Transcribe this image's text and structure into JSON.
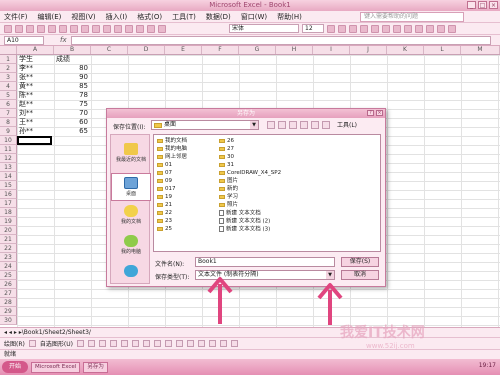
{
  "window": {
    "title": "Microsoft Excel - Book1"
  },
  "menu": {
    "items": [
      "文件(F)",
      "编辑(E)",
      "视图(V)",
      "插入(I)",
      "格式(O)",
      "工具(T)",
      "数据(D)",
      "窗口(W)",
      "帮助(H)"
    ],
    "help_placeholder": "键入需要帮助的问题"
  },
  "toolbar": {
    "font": "宋体",
    "size": "12"
  },
  "formula": {
    "namebox": "A10",
    "fx": "fx"
  },
  "columns": [
    "A",
    "B",
    "C",
    "D",
    "E",
    "F",
    "G",
    "H",
    "I",
    "J",
    "K",
    "L",
    "M"
  ],
  "rows": [
    "1",
    "2",
    "3",
    "4",
    "5",
    "6",
    "7",
    "8",
    "9",
    "10",
    "11",
    "12",
    "13",
    "14",
    "15",
    "16",
    "17",
    "18",
    "19",
    "20",
    "21",
    "22",
    "23",
    "24",
    "25",
    "26",
    "27",
    "28",
    "29",
    "30"
  ],
  "sheet": {
    "header": {
      "a": "学生",
      "b": "成绩"
    },
    "data": [
      {
        "name": "李**",
        "score": "80"
      },
      {
        "name": "张**",
        "score": "90"
      },
      {
        "name": "黄**",
        "score": "85"
      },
      {
        "name": "陈**",
        "score": "78"
      },
      {
        "name": "赵**",
        "score": "75"
      },
      {
        "name": "刘**",
        "score": "70"
      },
      {
        "name": "王**",
        "score": "60"
      },
      {
        "name": "孙**",
        "score": "65"
      }
    ]
  },
  "dialog": {
    "title": "另存为",
    "save_in_label": "保存位置(I):",
    "save_in_value": "桌面",
    "tools_label": "工具(L)",
    "places": [
      "我最近的文档",
      "桌面",
      "我的文档",
      "我的电脑",
      "网上邻居"
    ],
    "files_col1": [
      "我的文档",
      "我的电脑",
      "网上邻居",
      "01",
      "07",
      "09",
      "017",
      "19",
      "21",
      "22",
      "23",
      "25"
    ],
    "files_col2": [
      "26",
      "27",
      "30",
      "31",
      "CorelDRAW_X4_SP2",
      "图片",
      "新的",
      "学习",
      "照片",
      "新建 文本文档",
      "新建 文本文档 (2)",
      "新建 文本文档 (3)"
    ],
    "filename_label": "文件名(N):",
    "filename_value": "Book1",
    "filetype_label": "保存类型(T):",
    "filetype_value": "文本文件 (制表符分隔)",
    "save_button": "保存(S)",
    "cancel_button": "取消"
  },
  "sheettabs": {
    "text": "◂ ◂ ▸ ▸\\Book1/Sheet2/Sheet3/"
  },
  "drawbar": {
    "draw_label": "绘图(R)",
    "autoshape_label": "自选图形(U)"
  },
  "status": {
    "text": "就绪"
  },
  "taskbar": {
    "start": "开始",
    "clock": "19:17",
    "tasks": [
      "Microsoft Excel",
      "另存为"
    ]
  },
  "watermark": {
    "main": "我爱IT技术网",
    "sub": "www.52ij.com"
  },
  "colors": {
    "theme_pink": "#fbeaf1",
    "accent": "#e58fb3",
    "arrow": "#e0457f"
  }
}
